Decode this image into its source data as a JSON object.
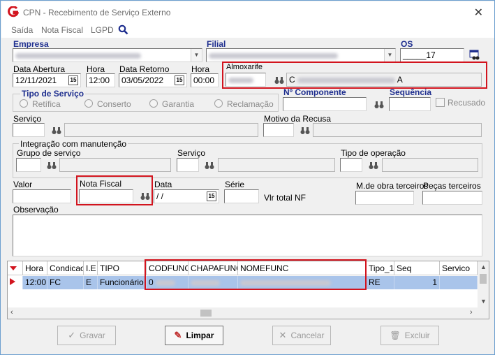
{
  "window": {
    "title": "CPN - Recebimento de Serviço Externo",
    "close": "✕"
  },
  "menu": {
    "saida": "Saída",
    "nota_fiscal": "Nota Fiscal",
    "lgpd": "LGPD"
  },
  "labels": {
    "empresa": "Empresa",
    "filial": "Filial",
    "os": "OS",
    "data_abertura": "Data Abertura",
    "hora": "Hora",
    "data_retorno": "Data Retorno",
    "hora2": "Hora",
    "almoxarife": "Almoxarife",
    "tipo_servico": "Tipo de Serviço",
    "n_componente": "Nº  Componente",
    "sequencia": "Sequência",
    "recusado": "Recusado",
    "servico": "Serviço",
    "motivo_recusa": "Motivo da Recusa",
    "integracao": "Integração com manutenção",
    "grupo_servico": "Grupo de serviço",
    "servico2": "Serviço",
    "tipo_operacao": "Tipo de operação",
    "valor": "Valor",
    "nota_fiscal": "Nota Fiscal",
    "data": "Data",
    "serie": "Série",
    "vlr_total_nf": "Vlr total NF",
    "mdo_terceiros": "M.de obra terceiros",
    "pecas_terceiros": "Peças terceiros",
    "observacao": "Observação"
  },
  "radios": [
    "Retífica",
    "Conserto",
    "Garantia",
    "Reclamação"
  ],
  "values": {
    "os": "_____17",
    "data_abertura": "12/11/2021",
    "hora": "12:00",
    "data_retorno": "03/05/2022",
    "hora_retorno": "00:00",
    "almoxarife_name_suffix": "A",
    "almoxarife_prefix": "C",
    "nf_data": " / /",
    "cal_label": "15"
  },
  "grid": {
    "columns": [
      "Hora",
      "Condicao",
      "I.E",
      "TIPO",
      "CODFUNC",
      "CHAPAFUNC",
      "NOMEFUNC",
      "Tipo_1",
      "Seq",
      "Servico"
    ],
    "row": {
      "hora": "12:00",
      "condicao": "FC",
      "ie": "E",
      "tipo": "Funcionário",
      "codfunc": "0",
      "tipo_1": "RE",
      "seq": "1"
    }
  },
  "buttons": {
    "gravar": "Gravar",
    "limpar": "Limpar",
    "cancelar": "Cancelar",
    "excluir": "Excluir"
  },
  "colors": {
    "accent": "#1f2f8f",
    "highlight": "#d2141e",
    "row_selected": "#a9c4ea",
    "logo": "#d2141e"
  }
}
